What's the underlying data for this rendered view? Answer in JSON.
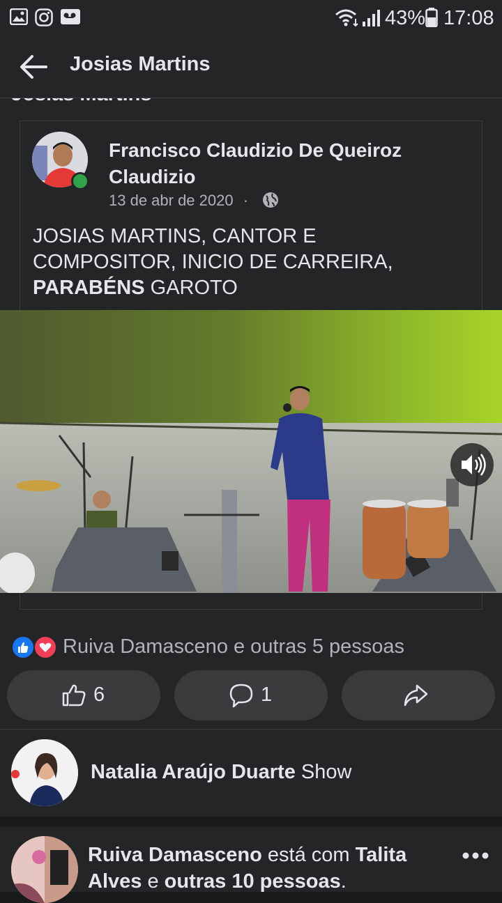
{
  "status_bar": {
    "battery": "43%",
    "time": "17:08",
    "icons": [
      "image-icon",
      "instagram-icon",
      "voicemail-icon",
      "wifi-icon",
      "signal-icon",
      "battery-icon"
    ]
  },
  "app_bar": {
    "title": "Josias Martins"
  },
  "page": {
    "cut_title": "Josias Martins"
  },
  "post": {
    "author": "Francisco Claudizio De Queiroz Claudizio",
    "date": "13 de abr de 2020",
    "separator": "·",
    "text_part1": "JOSIAS MARTINS, CANTOR E COMPOSITOR, INICIO DE CARREIRA, ",
    "text_bold": "PARABÉNS",
    "text_part2": " GAROTO"
  },
  "reactions": {
    "summary": "Ruiva Damasceno e outras 5 pessoas",
    "like_count": "6",
    "comment_count": "1"
  },
  "comments": [
    {
      "author": "Natalia Araújo Duarte",
      "text": " Show"
    },
    {
      "author": "Ruiva Damasceno",
      "text_mid": " está com ",
      "tagged": "Talita Alves",
      "text_end": " e ",
      "others": "outras 10 pessoas",
      "text_tail": "."
    }
  ],
  "colors": {
    "background": "#18191a",
    "surface": "#242526",
    "button": "#3a3b3c",
    "text_primary": "#e4e6eb",
    "text_secondary": "#b0b3b8",
    "like_blue": "#1877f2",
    "love_red": "#f33e58",
    "online_green": "#31a24c"
  }
}
